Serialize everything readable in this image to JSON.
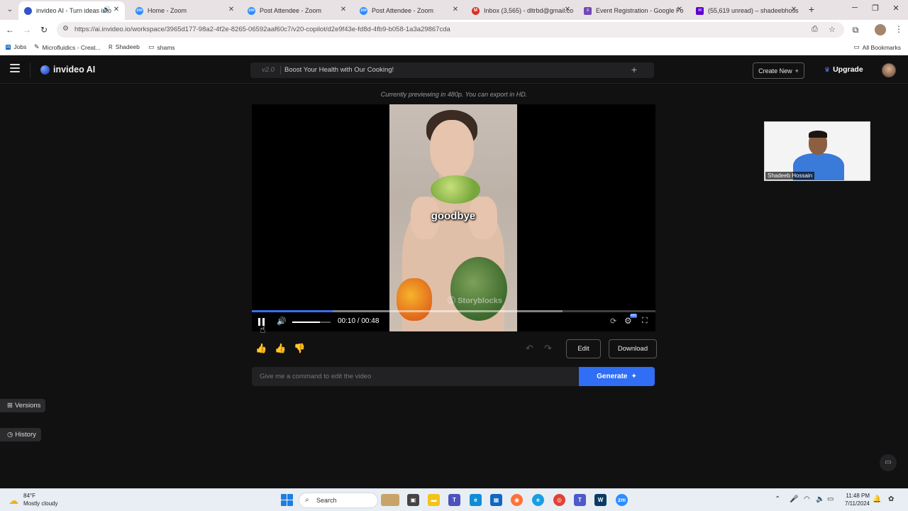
{
  "browser": {
    "tabs": [
      {
        "label": "invideo AI - Turn ideas into",
        "color": "#3453c9",
        "glyph": "",
        "active": true
      },
      {
        "label": "Home - Zoom",
        "color": "#2d8cff",
        "glyph": "zm"
      },
      {
        "label": "Post Attendee - Zoom",
        "color": "#2d8cff",
        "glyph": "zm"
      },
      {
        "label": "Post Attendee - Zoom",
        "color": "#2d8cff",
        "glyph": "zm"
      },
      {
        "label": "Inbox (3,565) - dltrbd@gmail.co",
        "color": "#d93025",
        "glyph": "M"
      },
      {
        "label": "Event Registration - Google Fo",
        "color": "#7248b9",
        "glyph": "≡"
      },
      {
        "label": "(55,619 unread) – shadeebhoss",
        "color": "#6001d2",
        "glyph": "✉"
      }
    ],
    "url": "https://ai.invideo.io/workspace/3965d177-98a2-4f2e-8265-06592aaf60c7/v20-copilot/d2e9f43e-fd8d-4fb9-b058-1a3a29867cda",
    "bookmarks": [
      {
        "label": "Jobs",
        "icon": "in"
      },
      {
        "label": "Microfluidics - Creat...",
        "icon": "✎"
      },
      {
        "label": "Shadeeb",
        "icon": "R"
      },
      {
        "label": "shams",
        "icon": "▭"
      }
    ],
    "all_bookmarks": "All Bookmarks"
  },
  "app": {
    "brand": "invideo AI",
    "project": {
      "version": "v2.0",
      "title": "Boost Your Health with Our Cooking!"
    },
    "create_new": "Create New",
    "upgrade": "Upgrade",
    "preview_note": "Currently previewing in 480p. You can export in HD.",
    "player": {
      "caption": "goodbye",
      "watermark": "Storyblocks",
      "time": "00:10 / 00:48",
      "progress_fraction": 0.2,
      "buffer_fraction": 0.77,
      "volume_fraction": 0.72,
      "quality": "480"
    },
    "actions": {
      "edit": "Edit",
      "download": "Download"
    },
    "command": {
      "placeholder": "Give me a command to edit the video",
      "generate": "Generate"
    },
    "sidebar": {
      "versions": "Versions",
      "history": "History"
    }
  },
  "zoom": {
    "participant": "Shadeeb Hossain"
  },
  "taskbar": {
    "weather_temp": "84°F",
    "weather_desc": "Mostly cloudy",
    "search": "Search",
    "time": "11:48 PM",
    "date": "7/11/2024"
  }
}
